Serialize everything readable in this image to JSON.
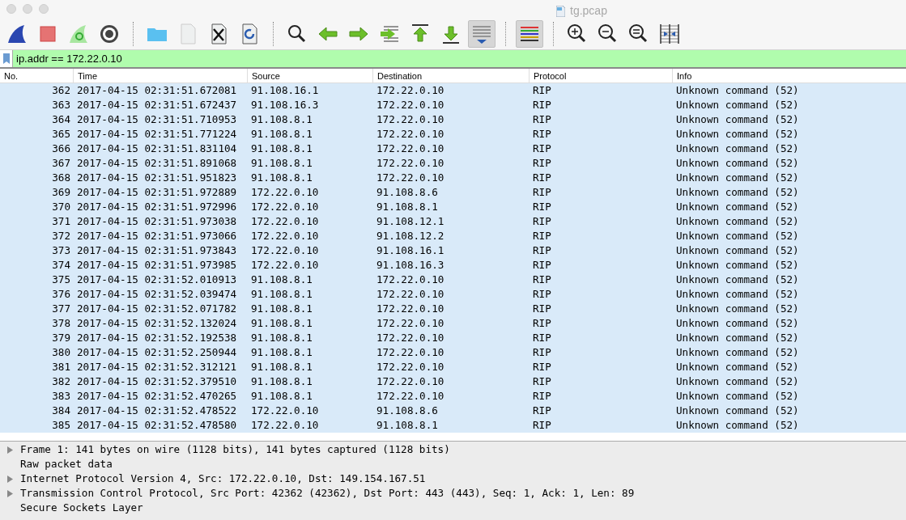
{
  "window": {
    "title": "tg.pcap"
  },
  "toolbar": [
    {
      "kind": "shark-start",
      "pressed": false
    },
    {
      "kind": "stop",
      "pressed": false
    },
    {
      "kind": "restart",
      "pressed": false
    },
    {
      "kind": "options",
      "pressed": false
    },
    {
      "kind": "separator"
    },
    {
      "kind": "folder",
      "pressed": false
    },
    {
      "kind": "file",
      "pressed": false
    },
    {
      "kind": "close-file",
      "pressed": false
    },
    {
      "kind": "reload",
      "pressed": false
    },
    {
      "kind": "separator"
    },
    {
      "kind": "search",
      "pressed": false
    },
    {
      "kind": "back",
      "pressed": false
    },
    {
      "kind": "forward",
      "pressed": false
    },
    {
      "kind": "goto",
      "pressed": false
    },
    {
      "kind": "first",
      "pressed": false
    },
    {
      "kind": "last",
      "pressed": false
    },
    {
      "kind": "autoscroll",
      "pressed": true
    },
    {
      "kind": "separator"
    },
    {
      "kind": "colorize",
      "pressed": true
    },
    {
      "kind": "separator"
    },
    {
      "kind": "zoom-in",
      "pressed": false
    },
    {
      "kind": "zoom-out",
      "pressed": false
    },
    {
      "kind": "zoom-reset",
      "pressed": false
    },
    {
      "kind": "resize-columns",
      "pressed": false
    }
  ],
  "filter": {
    "value": "ip.addr == 172.22.0.10"
  },
  "table": {
    "columns": [
      "No.",
      "Time",
      "Source",
      "Destination",
      "Protocol",
      "Info"
    ],
    "rows": [
      [
        "362",
        "2017-04-15 02:31:51.672081",
        "91.108.16.1",
        "172.22.0.10",
        "RIP",
        "Unknown command (52)"
      ],
      [
        "363",
        "2017-04-15 02:31:51.672437",
        "91.108.16.3",
        "172.22.0.10",
        "RIP",
        "Unknown command (52)"
      ],
      [
        "364",
        "2017-04-15 02:31:51.710953",
        "91.108.8.1",
        "172.22.0.10",
        "RIP",
        "Unknown command (52)"
      ],
      [
        "365",
        "2017-04-15 02:31:51.771224",
        "91.108.8.1",
        "172.22.0.10",
        "RIP",
        "Unknown command (52)"
      ],
      [
        "366",
        "2017-04-15 02:31:51.831104",
        "91.108.8.1",
        "172.22.0.10",
        "RIP",
        "Unknown command (52)"
      ],
      [
        "367",
        "2017-04-15 02:31:51.891068",
        "91.108.8.1",
        "172.22.0.10",
        "RIP",
        "Unknown command (52)"
      ],
      [
        "368",
        "2017-04-15 02:31:51.951823",
        "91.108.8.1",
        "172.22.0.10",
        "RIP",
        "Unknown command (52)"
      ],
      [
        "369",
        "2017-04-15 02:31:51.972889",
        "172.22.0.10",
        "91.108.8.6",
        "RIP",
        "Unknown command (52)"
      ],
      [
        "370",
        "2017-04-15 02:31:51.972996",
        "172.22.0.10",
        "91.108.8.1",
        "RIP",
        "Unknown command (52)"
      ],
      [
        "371",
        "2017-04-15 02:31:51.973038",
        "172.22.0.10",
        "91.108.12.1",
        "RIP",
        "Unknown command (52)"
      ],
      [
        "372",
        "2017-04-15 02:31:51.973066",
        "172.22.0.10",
        "91.108.12.2",
        "RIP",
        "Unknown command (52)"
      ],
      [
        "373",
        "2017-04-15 02:31:51.973843",
        "172.22.0.10",
        "91.108.16.1",
        "RIP",
        "Unknown command (52)"
      ],
      [
        "374",
        "2017-04-15 02:31:51.973985",
        "172.22.0.10",
        "91.108.16.3",
        "RIP",
        "Unknown command (52)"
      ],
      [
        "375",
        "2017-04-15 02:31:52.010913",
        "91.108.8.1",
        "172.22.0.10",
        "RIP",
        "Unknown command (52)"
      ],
      [
        "376",
        "2017-04-15 02:31:52.039474",
        "91.108.8.1",
        "172.22.0.10",
        "RIP",
        "Unknown command (52)"
      ],
      [
        "377",
        "2017-04-15 02:31:52.071782",
        "91.108.8.1",
        "172.22.0.10",
        "RIP",
        "Unknown command (52)"
      ],
      [
        "378",
        "2017-04-15 02:31:52.132024",
        "91.108.8.1",
        "172.22.0.10",
        "RIP",
        "Unknown command (52)"
      ],
      [
        "379",
        "2017-04-15 02:31:52.192538",
        "91.108.8.1",
        "172.22.0.10",
        "RIP",
        "Unknown command (52)"
      ],
      [
        "380",
        "2017-04-15 02:31:52.250944",
        "91.108.8.1",
        "172.22.0.10",
        "RIP",
        "Unknown command (52)"
      ],
      [
        "381",
        "2017-04-15 02:31:52.312121",
        "91.108.8.1",
        "172.22.0.10",
        "RIP",
        "Unknown command (52)"
      ],
      [
        "382",
        "2017-04-15 02:31:52.379510",
        "91.108.8.1",
        "172.22.0.10",
        "RIP",
        "Unknown command (52)"
      ],
      [
        "383",
        "2017-04-15 02:31:52.470265",
        "91.108.8.1",
        "172.22.0.10",
        "RIP",
        "Unknown command (52)"
      ],
      [
        "384",
        "2017-04-15 02:31:52.478522",
        "172.22.0.10",
        "91.108.8.6",
        "RIP",
        "Unknown command (52)"
      ],
      [
        "385",
        "2017-04-15 02:31:52.478580",
        "172.22.0.10",
        "91.108.8.1",
        "RIP",
        "Unknown command (52)"
      ]
    ]
  },
  "details": [
    {
      "text": "Frame 1: 141 bytes on wire (1128 bits), 141 bytes captured (1128 bits)",
      "expandable": true
    },
    {
      "text": "Raw packet data",
      "expandable": false
    },
    {
      "text": "Internet Protocol Version 4, Src: 172.22.0.10, Dst: 149.154.167.51",
      "expandable": true
    },
    {
      "text": "Transmission Control Protocol, Src Port: 42362 (42362), Dst Port: 443 (443), Seq: 1, Ack: 1, Len: 89",
      "expandable": true
    },
    {
      "text": "Secure Sockets Layer",
      "expandable": false
    }
  ]
}
